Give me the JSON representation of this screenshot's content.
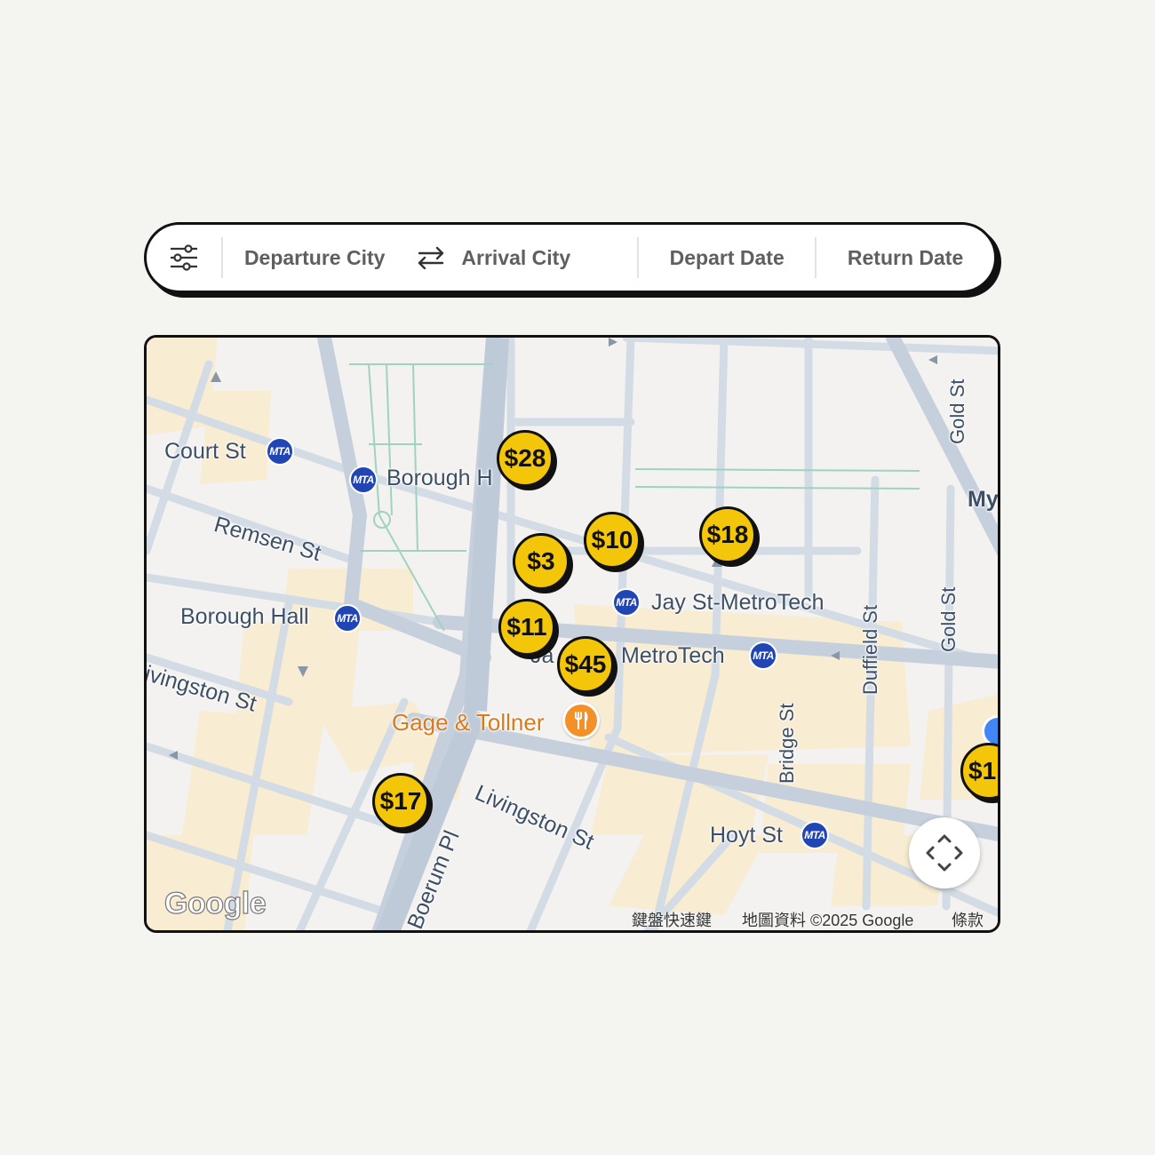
{
  "search": {
    "departure_label": "Departure City",
    "arrival_label": "Arrival City",
    "depart_date_label": "Depart Date",
    "return_date_label": "Return Date"
  },
  "map": {
    "labels": {
      "court_st": "Court St",
      "borough_hall_north": "Borough H",
      "remsen_st": "Remsen St",
      "borough_hall": "Borough Hall",
      "jay_st_metrotech": "Jay St-MetroTech",
      "metrotech": "MetroTech",
      "metrotech_cut": "Ja",
      "livingston_st_west": "ivingston St",
      "livingston_st": "Livingston St",
      "gage_tollner": "Gage & Tollner",
      "boerum_pl": "Boerum Pl",
      "bridge_st": "Bridge St",
      "duffield_st": "Duffield St",
      "gold_st_top": "Gold St",
      "gold_st": "Gold St",
      "my_cut": "My",
      "hoyt_st": "Hoyt St"
    },
    "transit_badge": "MTA",
    "price_markers": [
      "$28",
      "$10",
      "$18",
      "$3",
      "$11",
      "$45",
      "$17",
      "$1"
    ],
    "attribution": {
      "logo": "Google",
      "shortcuts": "鍵盤快速鍵",
      "map_data": "地圖資料 ©2025 Google",
      "terms": "條款"
    },
    "colors": {
      "marker_fill": "#f4c60a",
      "transit": "#2146b3",
      "poi": "#f39128",
      "building": "#f8ecd2",
      "road": "#cad3de"
    }
  }
}
